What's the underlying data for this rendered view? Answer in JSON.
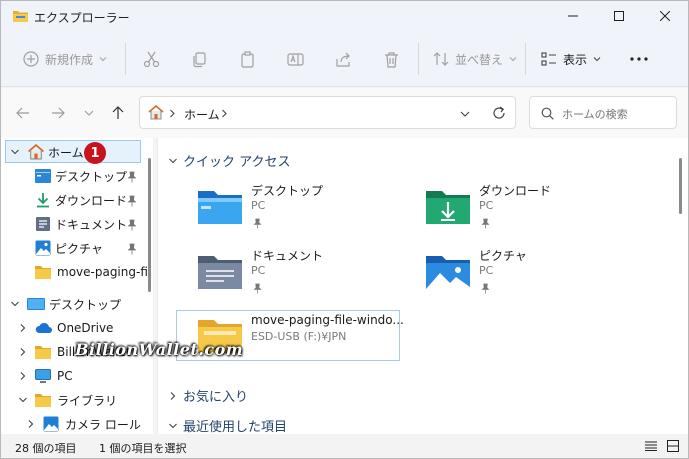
{
  "window": {
    "title": "エクスプローラー"
  },
  "toolbar": {
    "new_label": "新規作成",
    "sort_label": "並べ替え",
    "view_label": "表示"
  },
  "address": {
    "crumbs": [
      "ホーム"
    ],
    "search_placeholder": "ホームの検索"
  },
  "sidebar": {
    "items": [
      {
        "label": "ホーム",
        "icon": "home-icon"
      },
      {
        "label": "デスクトップ",
        "icon": "desktop-folder-icon",
        "pinned": true
      },
      {
        "label": "ダウンロード",
        "icon": "download-icon",
        "pinned": true
      },
      {
        "label": "ドキュメント",
        "icon": "documents-icon",
        "pinned": true
      },
      {
        "label": "ピクチャ",
        "icon": "pictures-icon",
        "pinned": true
      },
      {
        "label": "move-paging-fil",
        "icon": "folder-icon"
      },
      {
        "label": "デスクトップ",
        "icon": "desktop-icon"
      },
      {
        "label": "OneDrive",
        "icon": "cloud-icon"
      },
      {
        "label": "BillionWallet",
        "icon": "folder-icon"
      },
      {
        "label": "PC",
        "icon": "pc-icon"
      },
      {
        "label": "ライブラリ",
        "icon": "library-icon"
      },
      {
        "label": "カメラ ロール",
        "icon": "camera-roll-icon"
      }
    ],
    "badge": "1"
  },
  "main": {
    "quick_access": "クイック アクセス",
    "favorites": "お気に入り",
    "recent": "最近使用した項目",
    "tiles": [
      {
        "name": "デスクトップ",
        "sub": "PC"
      },
      {
        "name": "ダウンロード",
        "sub": "PC"
      },
      {
        "name": "ドキュメント",
        "sub": "PC"
      },
      {
        "name": "ピクチャ",
        "sub": "PC"
      },
      {
        "name": "move-paging-file-windo...",
        "sub": "ESD-USB (F:)¥JPN"
      }
    ]
  },
  "status": {
    "count": "28 個の項目",
    "selected": "1 個の項目を選択"
  },
  "watermark": "BillionWallet.com",
  "colors": {
    "accent": "#0067c0",
    "badge": "#c8121c",
    "selection": "#e5f1fb"
  }
}
